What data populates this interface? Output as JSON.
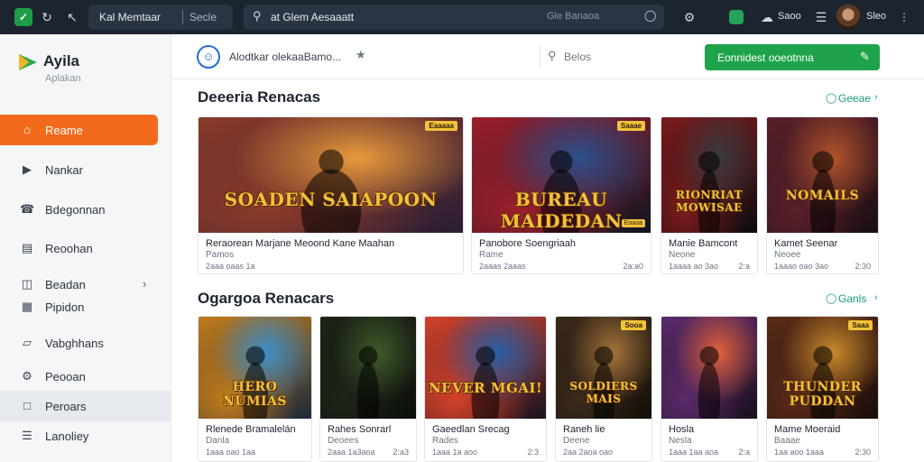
{
  "topbar": {
    "tab_title": "Kal Memtaar",
    "tab_search": "Secle",
    "address": "at Glem Aesaaatt",
    "address_right": "Gle Banaoa",
    "chat_label": "Saoo",
    "user_label": "Sleo"
  },
  "sidebar": {
    "brand_name": "Ayila",
    "brand_sub": "Aplakan",
    "items": [
      {
        "label": "Reame",
        "icon": "home-icon"
      },
      {
        "label": "Nankar",
        "icon": "controller-icon"
      },
      {
        "label": "Bdegonnan",
        "icon": "phone-icon"
      },
      {
        "label": "Reoohan",
        "icon": "library-icon"
      },
      {
        "label": "Beadan",
        "icon": "folder-icon",
        "has_chevron": true
      },
      {
        "label": "Pipidon",
        "icon": "list-icon"
      },
      {
        "label": "Vabghhans",
        "icon": "bookmark-icon"
      },
      {
        "label": "Peooan",
        "icon": "settings-icon"
      },
      {
        "label": "Peroars",
        "icon": "people-icon"
      },
      {
        "label": "Lanoliey",
        "icon": "document-icon"
      }
    ]
  },
  "header": {
    "title": "Alodtkar olekaaBamo...",
    "search_placeholder": "Belos",
    "cta_label": "Eonnidest ooeotnna"
  },
  "sections": [
    {
      "title": "Deeeria Renacas",
      "more_label": "Geeae",
      "cards": [
        {
          "title": "Reraorean Marjane Meoond Kane Maahan",
          "sub": "Pamos",
          "meta": "2aaa oaas 1a",
          "rating": "",
          "art_text": "SOADEN SAIAPOON",
          "tag": "Eaaaaa",
          "price": "",
          "palette": [
            "#e89b3b",
            "#8b3a2a",
            "#2a1d35"
          ]
        },
        {
          "title": "Panobore Soengriaah",
          "sub": "Rame",
          "meta": "2aaas 2aaas",
          "rating": "2a:a0",
          "art_text": "BUREAU MAIDEDAN",
          "tag": "Saaae",
          "price": "Eoaoa",
          "palette": [
            "#2b4f8c",
            "#9c1f2a",
            "#101522"
          ]
        },
        {
          "title": "Manie Bamcont",
          "sub": "Neone",
          "meta": "1aaaa ao 3ao",
          "rating": "2:a",
          "art_text": "RIONRIAT MOWISAE",
          "tag": "",
          "price": "",
          "palette": [
            "#3b3a3e",
            "#7a1b1b",
            "#0d0c10"
          ]
        },
        {
          "title": "Kamet Seenar",
          "sub": "Neoee",
          "meta": "1aaao oao 3ao",
          "rating": "2:30",
          "art_text": "NOMAILS",
          "tag": "",
          "price": "",
          "palette": [
            "#b0542a",
            "#5a1f2a",
            "#1a0f12"
          ]
        }
      ]
    },
    {
      "title": "Ogargoa Renacars",
      "more_label": "Ganls",
      "cards": [
        {
          "title": "Rlenede Bramalelán",
          "sub": "Danla",
          "meta": "1aaa oao 1aa",
          "rating": "",
          "art_text": "HERO NUMIAS",
          "tag": "",
          "price": "",
          "palette": [
            "#3b8ec9",
            "#c27b1a",
            "#1c2a3a"
          ]
        },
        {
          "title": "Rahes Sonrarl",
          "sub": "Deoees",
          "meta": "2aaa 1a3aoa",
          "rating": "2:a3",
          "art_text": "",
          "tag": "",
          "price": "",
          "palette": [
            "#3f5a2a",
            "#1d2418",
            "#0c100a"
          ]
        },
        {
          "title": "Gaeedlan Srecag",
          "sub": "Rades",
          "meta": "1aaa 1a aoo",
          "rating": "2:3",
          "art_text": "NEVER MGAI!",
          "tag": "",
          "price": "",
          "palette": [
            "#2a5fa8",
            "#d3412a",
            "#1a1420"
          ]
        },
        {
          "title": "Raneh lie",
          "sub": "Deene",
          "meta": "2aa 2aoa oao",
          "rating": "",
          "art_text": "SOLDIERS MAIS",
          "tag": "Sooa",
          "price": "",
          "palette": [
            "#a4733a",
            "#3a2a1a",
            "#15100a"
          ]
        },
        {
          "title": "Hosla",
          "sub": "Nesla",
          "meta": "1aaa 1aa aoa",
          "rating": "2:a",
          "art_text": "",
          "tag": "",
          "price": "",
          "palette": [
            "#e0603a",
            "#5a2a6a",
            "#1a0f1e"
          ]
        },
        {
          "title": "Mame Moeraid",
          "sub": "Baaae",
          "meta": "1aa aoo 1aaa",
          "rating": "2:30",
          "art_text": "THUNDER PUDDAN",
          "tag": "Saaa",
          "price": "",
          "palette": [
            "#c8892a",
            "#5a2a18",
            "#1a0e08"
          ]
        }
      ]
    }
  ]
}
